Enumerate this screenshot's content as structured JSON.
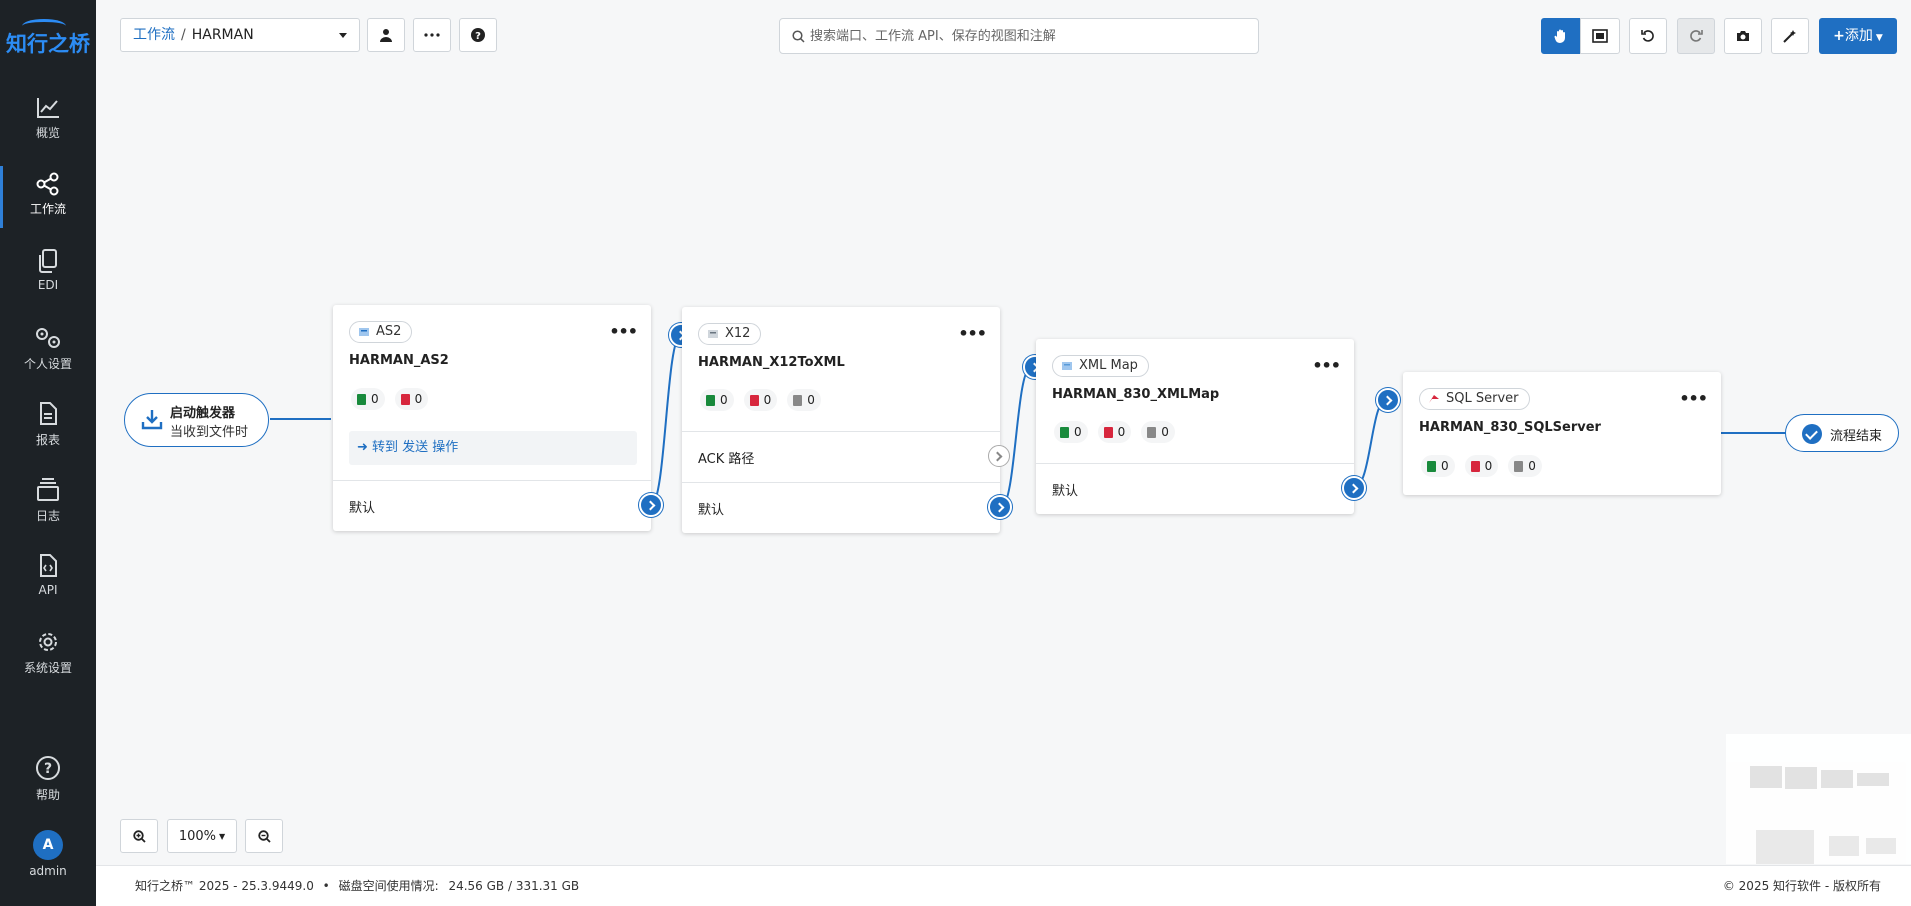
{
  "brand": {
    "logo_text": "知行之桥"
  },
  "sidebar": {
    "items": [
      {
        "label": "概览",
        "icon": "chart-line-icon"
      },
      {
        "label": "工作流",
        "icon": "share-nodes-icon",
        "active": true
      },
      {
        "label": "EDI",
        "icon": "copy-icon"
      },
      {
        "label": "个人设置",
        "icon": "gears-icon"
      },
      {
        "label": "报表",
        "icon": "file-icon"
      },
      {
        "label": "日志",
        "icon": "layers-icon"
      },
      {
        "label": "API",
        "icon": "file-code-icon"
      },
      {
        "label": "系统设置",
        "icon": "gear-icon"
      }
    ],
    "help_label": "帮助",
    "user": {
      "initial": "A",
      "name": "admin"
    }
  },
  "header": {
    "breadcrumb_root": "工作流",
    "breadcrumb_sep": "/",
    "breadcrumb_current": "HARMAN",
    "search_placeholder": "搜索端口、工作流 API、保存的视图和注解",
    "add_label": "添加"
  },
  "trigger": {
    "title": "启动触发器",
    "subtitle": "当收到文件时"
  },
  "nodes": [
    {
      "type_label": "AS2",
      "name": "HARMAN_AS2",
      "counts": [
        "0",
        "0"
      ],
      "action_label": "转到 发送 操作",
      "ports": [
        "默认"
      ]
    },
    {
      "type_label": "X12",
      "name": "HARMAN_X12ToXML",
      "counts": [
        "0",
        "0",
        "0"
      ],
      "ports": [
        "ACK 路径",
        "默认"
      ]
    },
    {
      "type_label": "XML Map",
      "name": "HARMAN_830_XMLMap",
      "counts": [
        "0",
        "0",
        "0"
      ],
      "ports": [
        "默认"
      ]
    },
    {
      "type_label": "SQL Server",
      "name": "HARMAN_830_SQLServer",
      "counts": [
        "0",
        "0",
        "0"
      ],
      "ports": []
    }
  ],
  "end_node": {
    "label": "流程结束"
  },
  "zoom": {
    "level": "100%"
  },
  "footer": {
    "version": "知行之桥™ 2025 - 25.3.9449.0",
    "bullet": "•",
    "disk_label": "磁盘空间使用情况:",
    "disk_value": "24.56 GB / 331.31 GB",
    "copyright": "© 2025 知行软件 - 版权所有"
  },
  "colors": {
    "accent": "#1f6fc2",
    "sidebar": "#1d2226",
    "success": "#198a3c",
    "error": "#d7263d"
  }
}
